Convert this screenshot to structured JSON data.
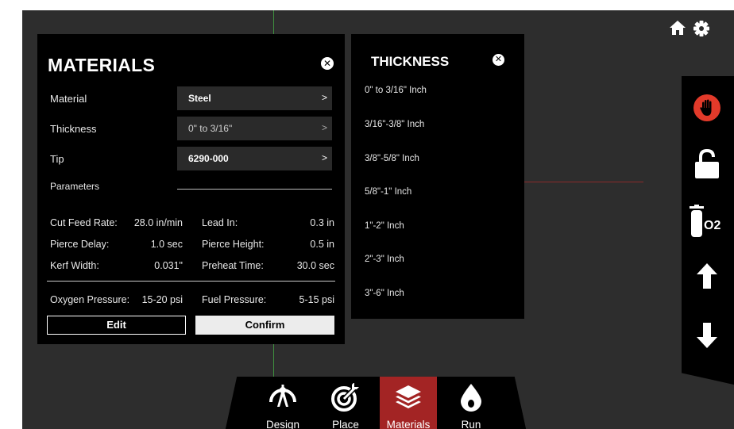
{
  "materials": {
    "title": "MATERIALS",
    "close_icon": "close-icon",
    "fields": [
      {
        "label": "Material",
        "value": "Steel"
      },
      {
        "label": "Thickness",
        "value": "0\" to 3/16\""
      },
      {
        "label": "Tip",
        "value": "6290-000"
      }
    ],
    "arrow": ">",
    "parameters_label": "Parameters",
    "params": {
      "cut_feed_rate": {
        "label": "Cut Feed Rate:",
        "value": "28.0 in/min"
      },
      "lead_in": {
        "label": "Lead In:",
        "value": "0.3 in"
      },
      "pierce_delay": {
        "label": "Pierce Delay:",
        "value": "1.0 sec"
      },
      "pierce_height": {
        "label": "Pierce Height:",
        "value": "0.5 in"
      },
      "kerf_width": {
        "label": "Kerf Width:",
        "value": "0.031\""
      },
      "preheat_time": {
        "label": "Preheat Time:",
        "value": "30.0 sec"
      },
      "oxygen_pressure": {
        "label": "Oxygen Pressure:",
        "value": "15-20 psi"
      },
      "fuel_pressure": {
        "label": "Fuel Pressure:",
        "value": "5-15 psi"
      }
    },
    "edit_label": "Edit",
    "confirm_label": "Confirm"
  },
  "thickness": {
    "title": "THICKNESS",
    "options": [
      "0\" to 3/16\" Inch",
      "3/16\"-3/8\" Inch",
      "3/8\"-5/8\" Inch",
      "5/8\"-1\" Inch",
      "1\"-2\" Inch",
      "2\"-3\" Inch",
      "3\"-6\" Inch"
    ]
  },
  "top_icons": [
    "home-icon",
    "gear-icon"
  ],
  "right_toolbar": {
    "items": [
      "stop-hand-icon",
      "unlock-icon",
      "oxygen-tank-icon",
      "arrow-up-icon",
      "arrow-down-icon"
    ],
    "o2_label": "O2",
    "stop_color": "#e23a2a"
  },
  "bottom_nav": {
    "items": [
      {
        "label": "Design",
        "icon": "design-icon"
      },
      {
        "label": "Place",
        "icon": "target-icon"
      },
      {
        "label": "Materials",
        "icon": "layers-icon",
        "active": true
      },
      {
        "label": "Run",
        "icon": "flame-icon"
      }
    ],
    "active_color": "#a32424"
  }
}
